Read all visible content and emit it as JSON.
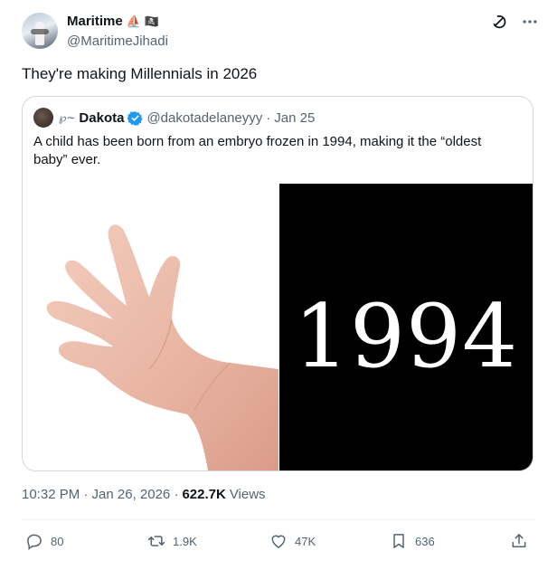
{
  "author": {
    "name": "Maritime",
    "emoji_1": "⛵",
    "emoji_2": "🏴‍☠️",
    "handle": "@MaritimeJihadi"
  },
  "tweet_text": "They're making Millennials in 2026",
  "quoted": {
    "name_prefix": "℘∼",
    "name": "Dakota",
    "handle": "@dakotadelaneyyy",
    "dot": "·",
    "date": "Jan 25",
    "text": "A child has been born from an embryo frozen in 1994, making it the “oldest baby” ever.",
    "image_text": "1994"
  },
  "meta": {
    "time": "10:32 PM · Jan 26, 2026 ·",
    "views": "622.7K",
    "views_label": "Views"
  },
  "actions": {
    "replies": "80",
    "reposts": "1.9K",
    "likes": "47K",
    "bookmarks": "636"
  },
  "colors": {
    "text": "#0f1419",
    "secondary": "#536471",
    "verified": "#1d9bf0",
    "border": "#cfd9de"
  },
  "icons": [
    "grok-icon",
    "more-icon",
    "verified-icon",
    "reply-icon",
    "repost-icon",
    "like-icon",
    "bookmark-icon",
    "share-icon"
  ]
}
